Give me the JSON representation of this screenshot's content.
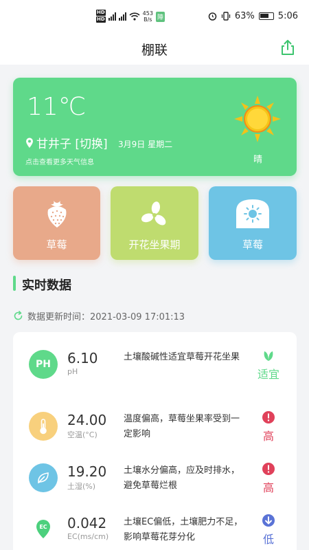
{
  "status_bar": {
    "hd1": "HD",
    "hd2": "HD",
    "net_speed_value": "453",
    "net_speed_unit": "B/s",
    "app_badge": "陣",
    "battery": "63%",
    "time": "5:06"
  },
  "header": {
    "title": "棚联"
  },
  "weather": {
    "temperature": "11℃",
    "location": "甘井子 [切换]",
    "date": "3月9日 星期二",
    "more_info": "点击查看更多天气信息",
    "condition": "晴"
  },
  "tiles": [
    {
      "label": "草莓",
      "icon": "strawberry-icon",
      "color": "#e8a98a"
    },
    {
      "label": "开花坐果期",
      "icon": "flower-icon",
      "color": "#bfdc6f"
    },
    {
      "label": "草莓",
      "icon": "greenhouse-icon",
      "color": "#6ec4e5"
    }
  ],
  "section": {
    "title": "实时数据"
  },
  "update": {
    "text": "数据更新时间：2021-03-09 17:01:13"
  },
  "readings": [
    {
      "icon": "ph-icon",
      "icon_text": "PH",
      "value": "6.10",
      "unit": "pH",
      "description": "土壤酸碱性适宜草莓开花坐果",
      "status": "适宜",
      "status_icon": "leaf-icon",
      "status_color": "#5fd98a"
    },
    {
      "icon": "thermometer-icon",
      "value": "24.00",
      "unit": "空温(°C)",
      "description": "温度偏高，草莓坐果率受到一定影响",
      "status": "高",
      "status_icon": "alert-icon",
      "status_color": "#e0415a"
    },
    {
      "icon": "soil-moisture-icon",
      "value": "19.20",
      "unit": "土湿(%)",
      "description": "土壤水分偏高，应及时排水，避免草莓烂根",
      "status": "高",
      "status_icon": "alert-icon",
      "status_color": "#e0415a"
    },
    {
      "icon": "ec-icon",
      "icon_text": "EC",
      "value": "0.042",
      "unit": "EC(ms/cm)",
      "description": "土壤EC偏低，土壤肥力不足，影响草莓花芽分化",
      "status": "低",
      "status_icon": "arrow-down-icon",
      "status_color": "#5a73d6"
    }
  ]
}
